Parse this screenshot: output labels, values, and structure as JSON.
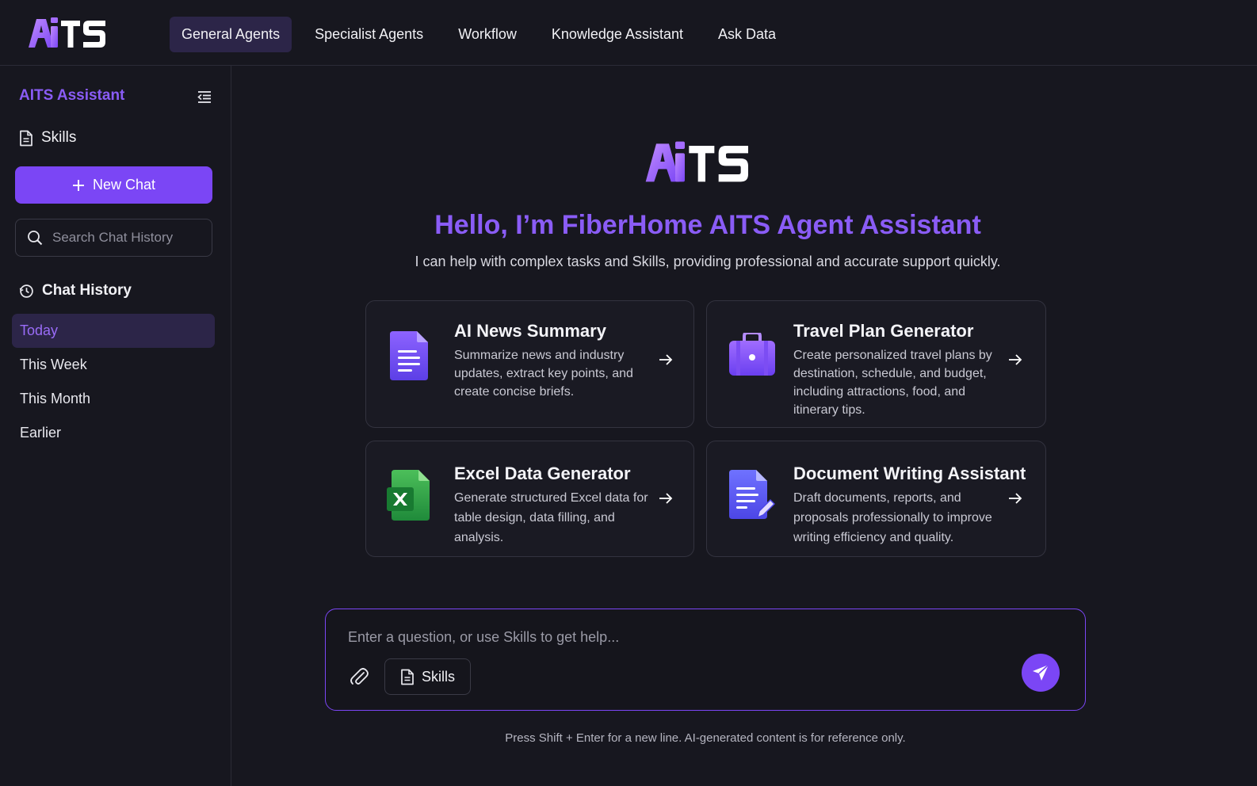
{
  "brand": {
    "logo_text": "AITS"
  },
  "nav": {
    "items": [
      {
        "label": "General Agents",
        "active": true
      },
      {
        "label": "Specialist Agents",
        "active": false
      },
      {
        "label": "Workflow",
        "active": false
      },
      {
        "label": "Knowledge Assistant",
        "active": false
      },
      {
        "label": "Ask Data",
        "active": false
      }
    ]
  },
  "sidebar": {
    "title": "AITS Assistant",
    "skills_label": "Skills",
    "new_chat_label": "New Chat",
    "search_placeholder": "Search Chat History",
    "history_title": "Chat History",
    "history_items": [
      {
        "label": "Today",
        "active": true
      },
      {
        "label": "This Week",
        "active": false
      },
      {
        "label": "This Month",
        "active": false
      },
      {
        "label": "Earlier",
        "active": false
      }
    ]
  },
  "hero": {
    "logo_text": "AITS",
    "title": "Hello, I’m FiberHome AITS Agent Assistant",
    "subtitle": "I can help with complex tasks and Skills, providing professional and accurate support quickly."
  },
  "cards": [
    {
      "title": "AI News Summary",
      "desc": [
        "Summarize news and industry",
        "updates, extract key points, and",
        "create concise briefs."
      ],
      "icon": "document-icon"
    },
    {
      "title": "Travel Plan Generator",
      "desc": [
        "Create personalized travel plans by",
        "destination, schedule, and budget,",
        "including attractions, food, and",
        "itinerary tips."
      ],
      "icon": "suitcase-icon"
    },
    {
      "title": "Excel Data Generator",
      "desc": [
        "Generate structured Excel data for",
        "table design, data filling, and",
        "analysis."
      ],
      "icon": "excel-icon"
    },
    {
      "title": "Document Writing Assistant",
      "desc": [
        "Draft documents, reports, and",
        "proposals professionally to improve",
        "writing efficiency and quality."
      ],
      "icon": "document-edit-icon"
    }
  ],
  "composer": {
    "placeholder": "Enter a question, or use Skills to get help...",
    "skills_label": "Skills",
    "footnote": "Press Shift + Enter for a new line. AI-generated content is for reference only."
  },
  "colors": {
    "accent": "#7b46f5",
    "accent_text": "#8a5cf6",
    "background": "#17171f",
    "active_bg": "#2c2548"
  }
}
